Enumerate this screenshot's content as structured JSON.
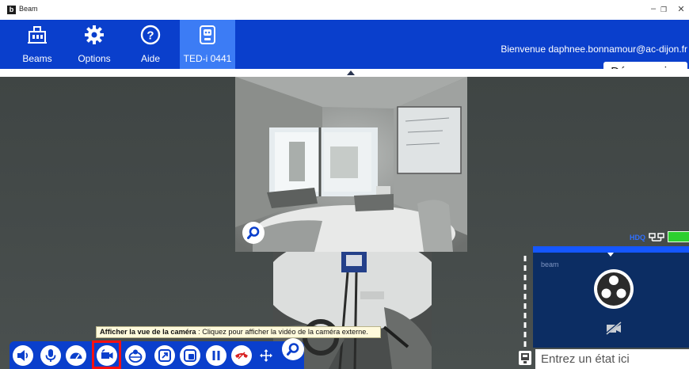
{
  "window": {
    "title": "Beam",
    "logo_letter": "b",
    "minimize": "–",
    "maximize": "❐",
    "close": "✕"
  },
  "nav": {
    "items": [
      {
        "label": "Beams",
        "icon": "beams-icon"
      },
      {
        "label": "Options",
        "icon": "gear-icon"
      },
      {
        "label": "Aide",
        "icon": "help-icon"
      },
      {
        "label": "TED-i 0441",
        "icon": "robot-icon",
        "active": true
      }
    ],
    "welcome": "Bienvenue daphnee.bonnamour@ac-dijon.fr",
    "logout": "Déconnexion"
  },
  "video": {
    "hd_label": "HDQ",
    "self_view_brand": "beam"
  },
  "status": {
    "placeholder": "Entrez un état ici"
  },
  "tooltip": {
    "title": "Afficher la vue de la caméra",
    "text": " : Cliquez pour afficher la vidéo de la caméra externe."
  },
  "toolbar": {
    "buttons": [
      "speaker-icon",
      "microphone-icon",
      "speed-gauge-icon",
      "external-camera-icon",
      "robot-view-icon",
      "fullscreen-icon",
      "picture-in-picture-icon",
      "pause-icon",
      "hang-up-icon",
      "move-icon",
      "zoom-icon"
    ],
    "highlighted": "external-camera-icon"
  },
  "colors": {
    "nav_bg": "#0a3fcc",
    "nav_active": "#3c7cf5",
    "stage_bg": "#414746",
    "highlight": "#ff1010",
    "signal": "#2ccf2e"
  }
}
